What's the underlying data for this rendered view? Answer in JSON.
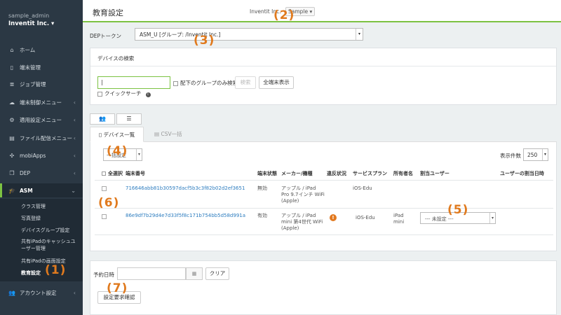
{
  "sidebar": {
    "user": "sample_admin",
    "org": "Inventit Inc.",
    "org_caret": "▾",
    "items": [
      {
        "label": "ホーム",
        "icon": "⌂"
      },
      {
        "label": "端末管理",
        "icon": "▯"
      },
      {
        "label": "ジョブ管理",
        "icon": "≣"
      },
      {
        "label": "端末制御メニュー",
        "icon": "☁"
      },
      {
        "label": "適用設定メニュー",
        "icon": "⚙"
      },
      {
        "label": "ファイル配信メニュー",
        "icon": "▤"
      },
      {
        "label": "mobiApps",
        "icon": "✣"
      },
      {
        "label": "DEP",
        "icon": "❐"
      },
      {
        "label": "ASM",
        "icon": "🎓"
      },
      {
        "label": "アカウント設定",
        "icon": "👥"
      }
    ],
    "asm_sub": [
      "クラス管理",
      "写真登録",
      "デバイスグループ設定",
      "共有iPadのキャッシュユーザー管理",
      "共有iPadの画面設定",
      "教育設定"
    ]
  },
  "header": {
    "title": "教育設定",
    "tenant": "Inventit Inc.",
    "tenant_btn": "Sample ▾"
  },
  "dep": {
    "label": "DEPトークン",
    "value": "ASM_U [グループ: /Inventit Inc.]",
    "caret": "▾"
  },
  "search": {
    "heading": "デバイスの検索",
    "input_value": "|",
    "only_subgroup": "配下のグループのみ検索",
    "search_btn": "検索",
    "show_all_btn": "全端末表示",
    "quick_search": "クイックサーチ",
    "info": "i"
  },
  "tabs": {
    "device_list": "デバイス一覧",
    "csv": "CSV一括",
    "toggle_group": "👥",
    "toggle_list": "☰"
  },
  "list": {
    "bulk_btn": "一括設定",
    "count_label": "表示件数",
    "count_value": "250",
    "headers": [
      "全選択",
      "端末番号",
      "端末状態",
      "メーカー/機種",
      "違反状況",
      "サービスプラン",
      "所有者名",
      "割当ユーザー",
      "ユーザーの割当日時"
    ],
    "rows": [
      {
        "serial": "716646abb81b30597dacf5b3c3f82b02d2ef3651",
        "status": "無効",
        "model": "アップル / iPad Pro 9.7インチ WiFi (Apple)",
        "violation": "",
        "plan": "iOS-Edu",
        "owner": "",
        "user": ""
      },
      {
        "serial": "86e9df7b29d4e7d33f5f8c171b754bb5d58d991a",
        "status": "有効",
        "model": "アップル / iPad mini 第4世代 WiFi (Apple)",
        "violation": "!",
        "plan": "iOS-Edu",
        "owner": "iPad mini",
        "user": "--- 未設定 ---"
      }
    ]
  },
  "schedule": {
    "label": "予約日時",
    "cal": "▦",
    "clear_btn": "クリア",
    "confirm_btn": "設定要求確認"
  },
  "annotations": [
    "(1)",
    "(2)",
    "(3)",
    "(4)",
    "(5)",
    "(6)",
    "(7)"
  ],
  "colors": {
    "accent": "#7cc242",
    "sidebar": "#2b3844",
    "annotation": "#e07a1e",
    "link": "#2c7cbf"
  }
}
